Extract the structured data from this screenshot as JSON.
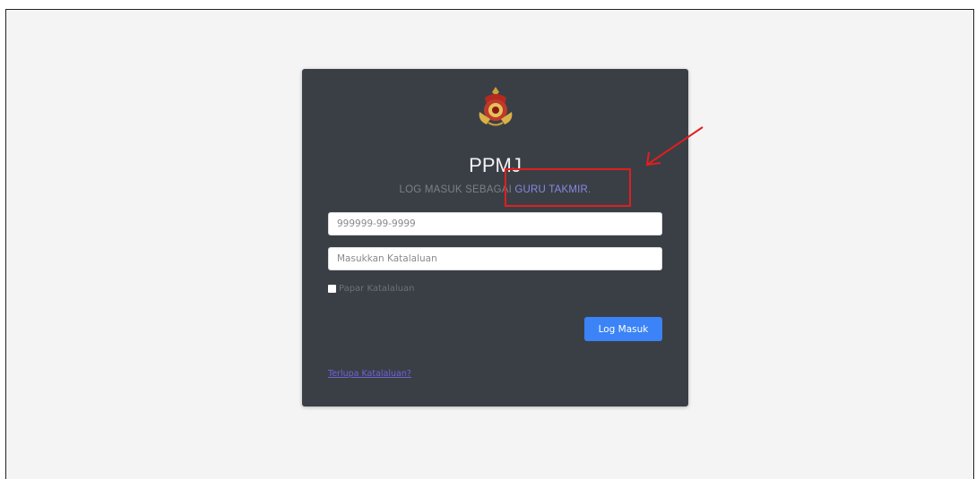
{
  "login": {
    "app_title": "PPMJ",
    "subtitle_prefix": "LOG MASUK SEBAGAI ",
    "subtitle_role": "GURU TAKMIR",
    "subtitle_suffix": ".",
    "ic_placeholder": "999999-99-9999",
    "password_placeholder": "Masukkan Katalaluan",
    "show_password_label": "Papar Katalaluan",
    "submit_label": "Log Masuk",
    "forgot_label": "Terlupa Katalaluan?"
  },
  "colors": {
    "card_bg": "#3a3f46",
    "primary_button": "#3b83f6",
    "role_text": "#8a88e0",
    "annotation": "#e21e1e"
  },
  "icons": {
    "logo": "state-crest-logo"
  }
}
